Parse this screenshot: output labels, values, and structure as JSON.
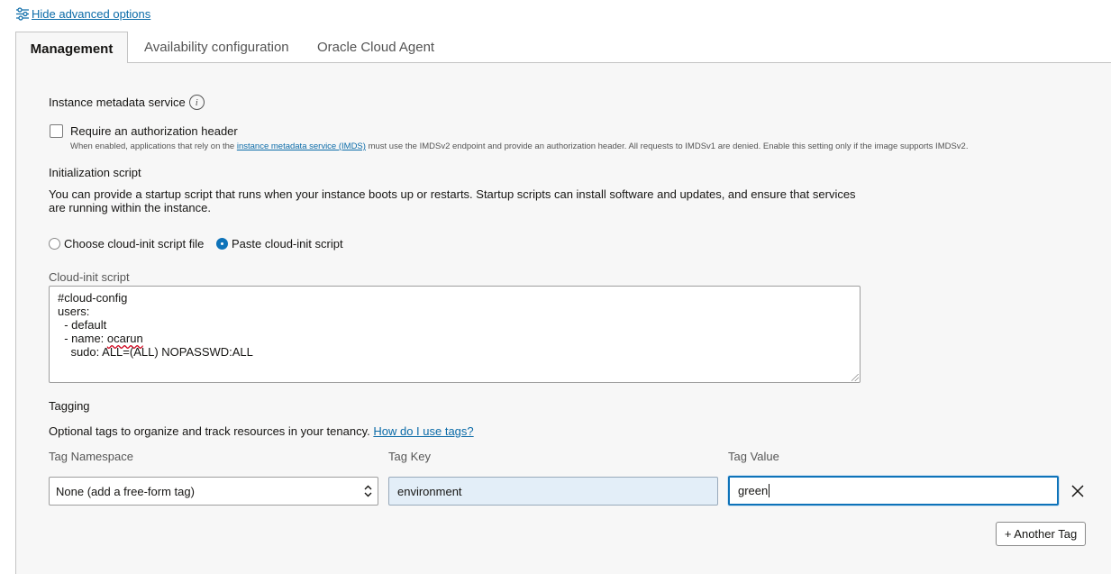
{
  "advanced": {
    "toggle_label": "Hide advanced options"
  },
  "tabs": [
    {
      "label": "Management",
      "active": true
    },
    {
      "label": "Availability configuration",
      "active": false
    },
    {
      "label": "Oracle Cloud Agent",
      "active": false
    }
  ],
  "metadata": {
    "title": "Instance metadata service",
    "info_glyph": "i",
    "checkbox_label": "Require an authorization header",
    "checked": false,
    "help_before": "When enabled, applications that rely on the ",
    "help_link": "instance metadata service (IMDS)",
    "help_after": " must use the IMDSv2 endpoint and provide an authorization header. All requests to IMDSv1 are denied. Enable this setting only if the image supports IMDSv2."
  },
  "init_script": {
    "title": "Initialization script",
    "description_line1": "You can provide a startup script that runs when your instance boots up or restarts. Startup scripts can install software and updates, and ensure that services",
    "description_line2": "are running within the instance.",
    "option_file": "Choose cloud-init script file",
    "option_paste": "Paste cloud-init script",
    "selected": "paste",
    "script_label": "Cloud-init script",
    "script_lines": [
      "#cloud-config",
      "users:",
      "  - default",
      "  - name: ",
      "    sudo: ALL=(ALL) NOPASSWD:ALL"
    ],
    "script_username": "ocarun"
  },
  "tagging": {
    "title": "Tagging",
    "description": "Optional tags to organize and track resources in your tenancy.",
    "help_link": "How do I use tags?",
    "namespace_header": "Tag Namespace",
    "key_header": "Tag Key",
    "value_header": "Tag Value",
    "namespace_value": "None (add a free-form tag)",
    "key_value": "environment",
    "value_value": "green",
    "add_button": "+ Another Tag"
  },
  "icons": {
    "toggle": "sliders-icon",
    "info": "info-icon",
    "select_arrows": "chevron-updown-icon",
    "remove": "close-icon"
  }
}
